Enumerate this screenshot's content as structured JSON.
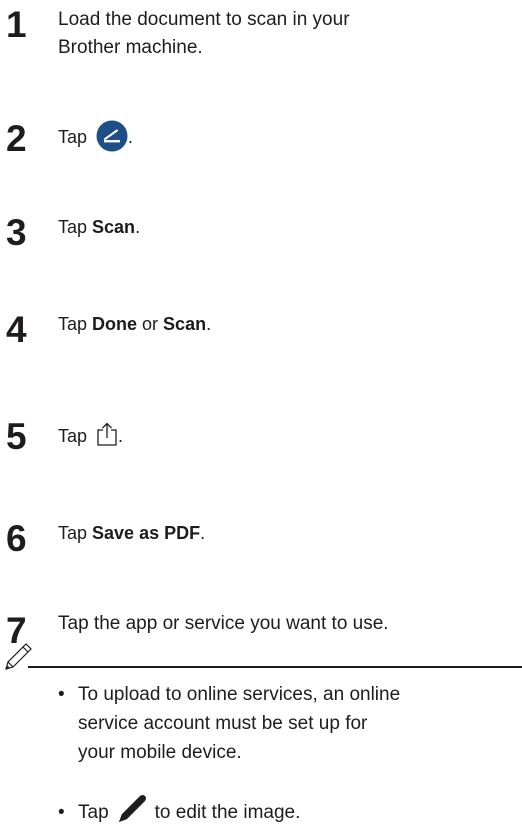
{
  "steps": [
    {
      "num": "1",
      "line1": "Load the document to scan in your",
      "line2": "Brother machine."
    },
    {
      "num": "2",
      "pre": "Tap",
      "post": "."
    },
    {
      "num": "3",
      "pre": "Tap ",
      "bold1": "Scan",
      "post": "."
    },
    {
      "num": "4",
      "pre": "Tap ",
      "bold1": "Done",
      "mid": " or ",
      "bold2": "Scan",
      "post": "."
    },
    {
      "num": "5",
      "pre": "Tap",
      "post": "."
    },
    {
      "num": "6",
      "pre": "Tap ",
      "bold1": "Save as PDF",
      "post": "."
    },
    {
      "num": "7",
      "text": "Tap the app or service you want to use."
    }
  ],
  "note": {
    "bullet_char": "•",
    "b1_line1": "To upload to online services, an online",
    "b1_line2": "service account must be set up for",
    "b1_line3": "your mobile device.",
    "b2_pre": "Tap",
    "b2_post": "to edit the image."
  },
  "icons": {
    "step2": "scan-circle-icon",
    "step5": "share-icon",
    "note": "note-pencil-icon",
    "bullet2": "edit-pencil-icon"
  },
  "colors": {
    "text": "#1f1c1d",
    "scan_icon_bg": "#1e4f8a"
  }
}
